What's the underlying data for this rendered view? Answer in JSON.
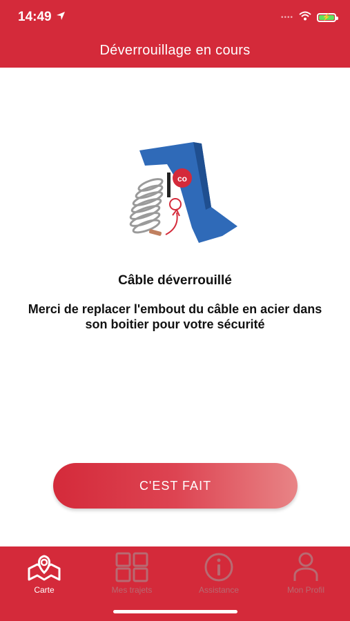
{
  "status_bar": {
    "time": "14:49"
  },
  "header": {
    "title": "Déverrouillage en cours"
  },
  "main": {
    "heading": "Câble déverrouillé",
    "message": "Merci de replacer l'embout du câble en acier dans son boitier pour votre sécurité",
    "done_button": "C'EST FAIT"
  },
  "tabbar": {
    "tabs": [
      {
        "label": "Carte",
        "icon": "map-icon",
        "active": true
      },
      {
        "label": "Mes trajets",
        "icon": "grid-icon",
        "active": false
      },
      {
        "label": "Assistance",
        "icon": "info-icon",
        "active": false
      },
      {
        "label": "Mon Profil",
        "icon": "person-icon",
        "active": false
      }
    ]
  },
  "colors": {
    "brand": "#d42a3a",
    "inactive_tab": "#b86a72",
    "illustration_blue": "#2f6ab8"
  }
}
